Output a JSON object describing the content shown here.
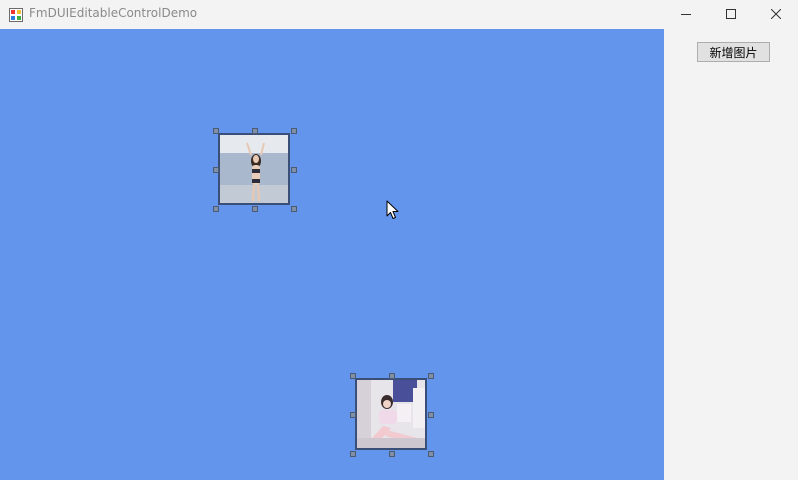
{
  "window": {
    "title": "FmDUIEditableControlDemo"
  },
  "panel": {
    "add_image_label": "新增图片"
  },
  "colors": {
    "canvas": "#6495ed",
    "panel": "#f3f3f3",
    "handle": "#7f8fa6"
  }
}
